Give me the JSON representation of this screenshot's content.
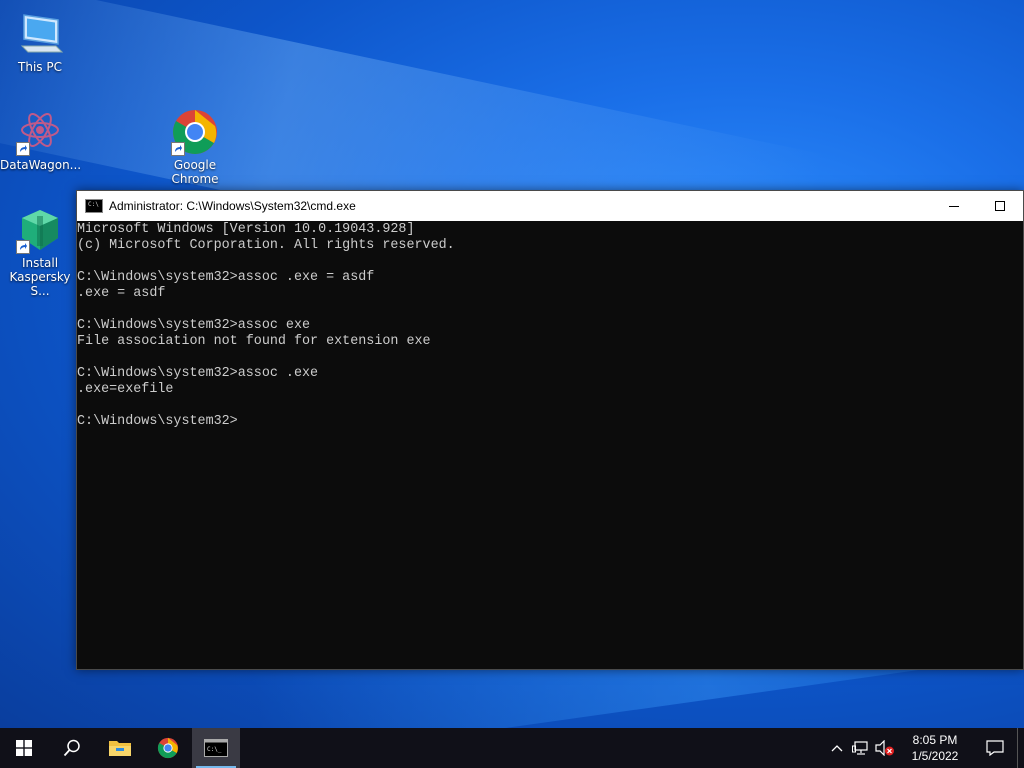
{
  "desktop": {
    "icons": [
      {
        "label": "This PC",
        "icon": "computer-icon"
      },
      {
        "label": "DataWagon...",
        "icon": "datawagon-icon"
      },
      {
        "label": "Google\nChrome",
        "icon": "chrome-icon"
      },
      {
        "label": "Install\nKaspersky S...",
        "icon": "kaspersky-install-icon"
      }
    ]
  },
  "window": {
    "title": "Administrator: C:\\Windows\\System32\\cmd.exe",
    "controls": {
      "minimize": "minimize-icon",
      "maximize": "maximize-icon"
    },
    "console_lines": [
      "Microsoft Windows [Version 10.0.19043.928]",
      "(c) Microsoft Corporation. All rights reserved.",
      "",
      "C:\\Windows\\system32>assoc .exe = asdf",
      ".exe = asdf",
      "",
      "C:\\Windows\\system32>assoc exe",
      "File association not found for extension exe",
      "",
      "C:\\Windows\\system32>assoc .exe",
      ".exe=exefile",
      "",
      "C:\\Windows\\system32>"
    ]
  },
  "taskbar": {
    "clock_time": "8:05 PM",
    "clock_date": "1/5/2022",
    "colors": {
      "background": "#101018",
      "accent": "#76b9ed"
    }
  }
}
